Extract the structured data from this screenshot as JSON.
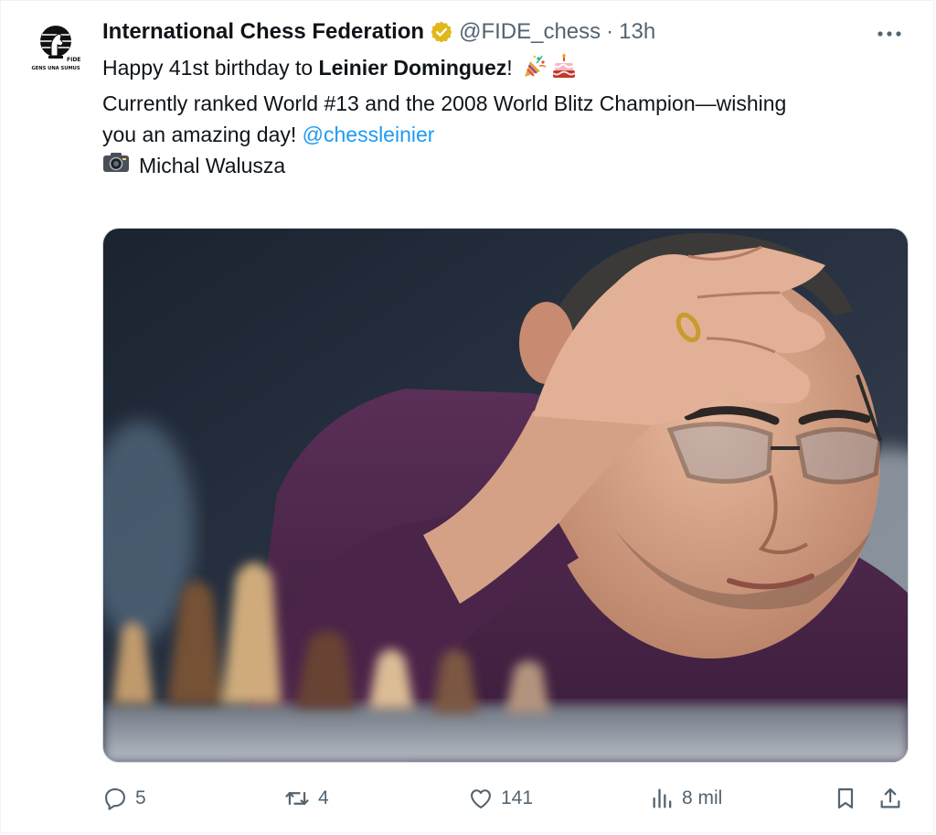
{
  "author": {
    "display_name": "International Chess Federation",
    "handle": "@FIDE_chess",
    "separator": "·",
    "time": "13h",
    "avatar": {
      "logo_text": "FIDE",
      "motto": "GENS UNA SUMUS"
    },
    "verified_color": "#e2b719"
  },
  "tweet": {
    "line1_prefix": "Happy 41st birthday to ",
    "line1_bold": "Leinier Dominguez",
    "line1_suffix": "!",
    "line2": "Currently ranked World #13 and the 2008 World Blitz Champion—wishing",
    "line3_text": "you an amazing day! ",
    "mention": "@chessleinier",
    "photo_credit": "Michal Walusza",
    "emojis": [
      "party-popper-icon",
      "birthday-cake-icon"
    ]
  },
  "actions": {
    "replies": "5",
    "reposts": "4",
    "likes": "141",
    "views": "8 mil"
  },
  "colors": {
    "accent": "#1d9bf0",
    "muted": "#536471",
    "text": "#0f1419"
  }
}
